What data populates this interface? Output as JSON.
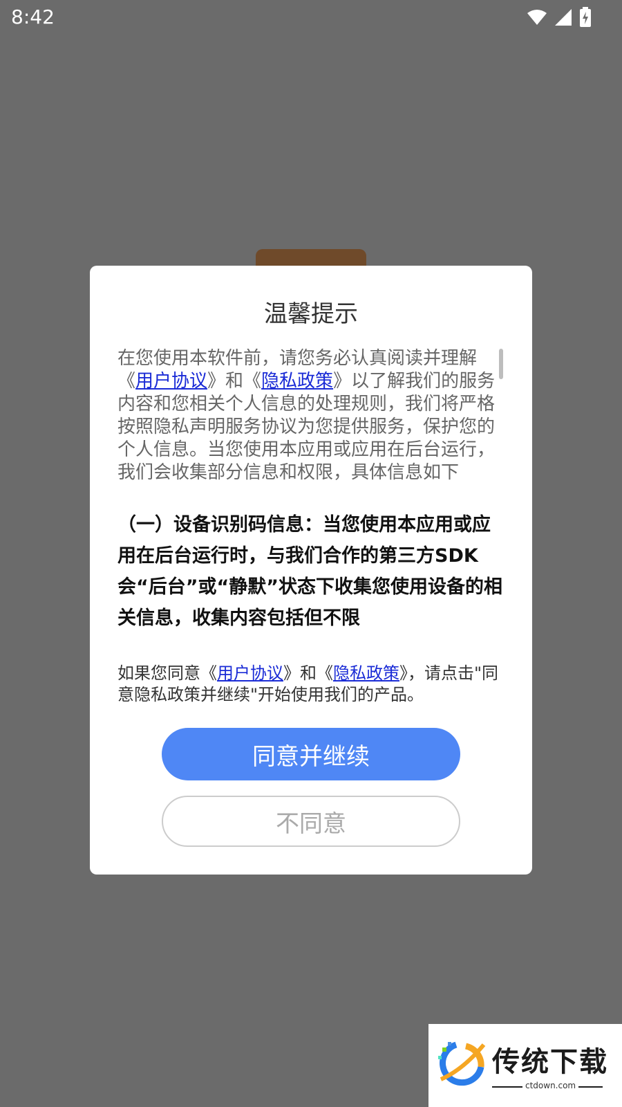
{
  "status_bar": {
    "time": "8:42"
  },
  "dialog": {
    "title": "温馨提示",
    "intro": {
      "part1": "在您使用本软件前，请您务必认真阅读并理解《",
      "link1": "用户协议",
      "part2": "》和《",
      "link2": "隐私政策",
      "part3": "》以了解我们的服务内容和您相关个人信息的处理规则，我们将严格按照隐私声明服务协议为您提供服务，保护您的个人信息。当您使用本应用或应用在后台运行，我们会收集部分信息和权限，具体信息如下"
    },
    "section1": "（一）设备识别码信息：当您使用本应用或应用在后台运行时，与我们合作的第三方SDK会“后台”或“静默”状态下收集您使用设备的相关信息，收集内容包括但不限",
    "agree_text": {
      "part1": "如果您同意《",
      "link1": "用户协议",
      "part2": "》和《",
      "link2": "隐私政策",
      "part3": "》，请点击\"同意隐私政策并继续\"开始使用我们的产品。"
    },
    "agree_button": "同意并继续",
    "disagree_button": "不同意"
  },
  "watermark": {
    "brand": "传统下载",
    "domain": "ctdown.com"
  },
  "colors": {
    "accent": "#4f87f5",
    "link": "#1a2bd6",
    "overlay": "#6b6b6b"
  }
}
